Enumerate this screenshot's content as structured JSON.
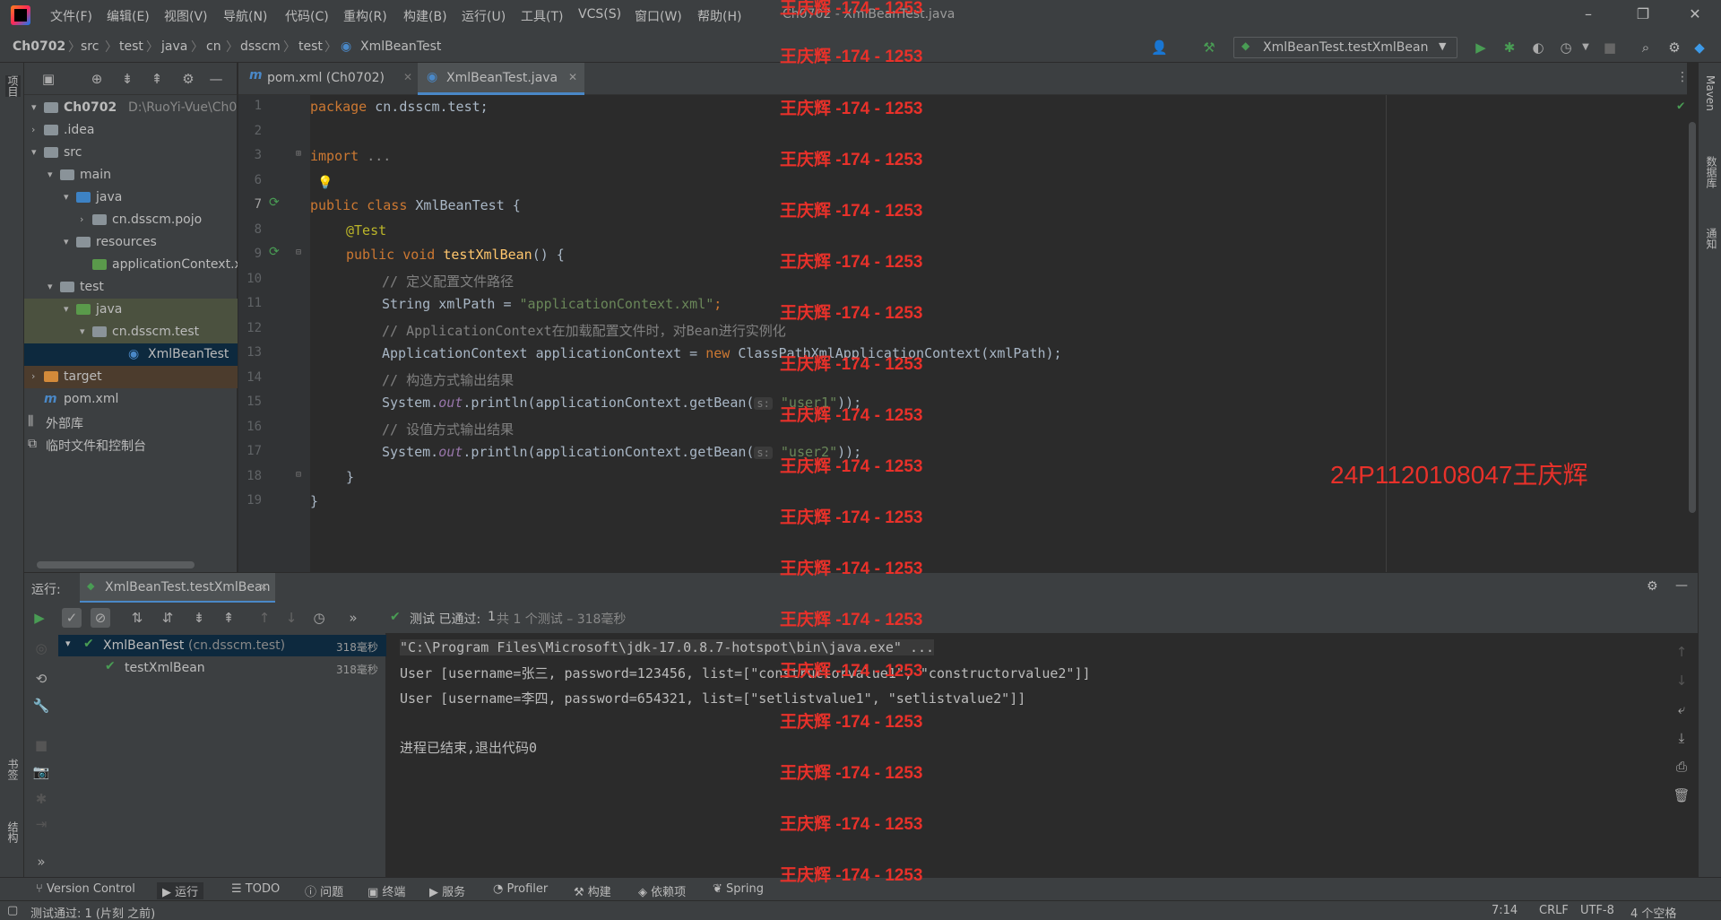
{
  "menu": [
    "文件(F)",
    "编辑(E)",
    "视图(V)",
    "导航(N)",
    "代码(C)",
    "重构(R)",
    "构建(B)",
    "运行(U)",
    "工具(T)",
    "VCS(S)",
    "窗口(W)",
    "帮助(H)"
  ],
  "window_title": "Ch0702 - XmlBeanTest.java",
  "breadcrumb": [
    "Ch0702",
    "src",
    "test",
    "java",
    "cn",
    "dsscm",
    "test",
    "XmlBeanTest"
  ],
  "run_config": "XmlBeanTest.testXmlBean",
  "left_strip": {
    "project_label": "项目",
    "bookmarks_label": "书签",
    "structure_label": "结构"
  },
  "right_strip": {
    "maven_label": "Maven",
    "database_label": "数据库",
    "notifications_label": "通知"
  },
  "project_tree": {
    "root_name": "Ch0702",
    "root_path": "D:\\RuoYi-Vue\\Ch0702",
    "items": [
      ".idea",
      "src",
      "main",
      "java",
      "cn.dsscm.pojo",
      "resources",
      "applicationContext.xml",
      "test",
      "java",
      "cn.dsscm.test",
      "XmlBeanTest",
      "target",
      "pom.xml",
      "外部库",
      "临时文件和控制台"
    ]
  },
  "editor_tabs": [
    "pom.xml (Ch0702)",
    "XmlBeanTest.java"
  ],
  "line_numbers": [
    "1",
    "2",
    "3",
    "6",
    "7",
    "8",
    "9",
    "10",
    "11",
    "12",
    "13",
    "14",
    "15",
    "16",
    "17",
    "18",
    "19"
  ],
  "code": {
    "l1_kw": "package",
    "l1_rest": " cn.dsscm.test;",
    "l3_kw": "import",
    "l3_rest": " ...",
    "l7_kw": "public class",
    "l7_cls": " XmlBeanTest",
    "l7_rest": " {",
    "l8": "@Test",
    "l9_kw": "public void",
    "l9_fn": " testXmlBean",
    "l9_rest": "() {",
    "l10": "// 定义配置文件路径",
    "l11_a": "String xmlPath = ",
    "l11_str": "\"applicationContext.xml\"",
    "l11_b": ";",
    "l12": "// ApplicationContext在加载配置文件时，对Bean进行实例化",
    "l13_a": "ApplicationContext applicationContext = ",
    "l13_kw": "new",
    "l13_b": " ClassPathXmlApplicationContext(xmlPath);",
    "l14": "// 构造方式输出结果",
    "l15_a": "System.",
    "l15_out": "out",
    "l15_b": ".println(applicationContext.getBean(",
    "l15_hint": "s:",
    "l15_str": " \"user1\"",
    "l15_c": "));",
    "l16": "// 设值方式输出结果",
    "l17_a": "System.",
    "l17_out": "out",
    "l17_b": ".println(applicationContext.getBean(",
    "l17_hint": "s:",
    "l17_str": " \"user2\"",
    "l17_c": "));",
    "l18": "}",
    "l19": "}"
  },
  "run_panel": {
    "label": "运行:",
    "tab": "XmlBeanTest.testXmlBean",
    "status_prefix": "测试 已通过:",
    "status_count": "1",
    "status_detail": "共 1 个测试 – 318毫秒",
    "tests": [
      {
        "name": "XmlBeanTest",
        "pkg": " (cn.dsscm.test)",
        "time": "318毫秒"
      },
      {
        "name": "testXmlBean",
        "pkg": "",
        "time": "318毫秒"
      }
    ],
    "console": [
      "\"C:\\Program Files\\Microsoft\\jdk-17.0.8.7-hotspot\\bin\\java.exe\" ...",
      "User [username=张三, password=123456, list=[\"constructorvalue1\", \"constructorvalue2\"]]",
      "User [username=李四, password=654321, list=[\"setlistvalue1\", \"setlistvalue2\"]]",
      "",
      "进程已结束,退出代码0"
    ]
  },
  "bottom_tabs": [
    "Version Control",
    "运行",
    "TODO",
    "问题",
    "终端",
    "服务",
    "Profiler",
    "构建",
    "依赖项",
    "Spring"
  ],
  "status": {
    "left": "测试通过: 1 (片刻 之前)",
    "position": "7:14",
    "line_sep": "CRLF",
    "encoding": "UTF-8",
    "indent": "4 个空格"
  },
  "watermark": "王庆辉 -174 - 1253",
  "big_watermark": "24P1120108047王庆辉",
  "colors": {
    "accent": "#4a88c7",
    "pass": "#499c54",
    "watermark": "#e8312a"
  }
}
